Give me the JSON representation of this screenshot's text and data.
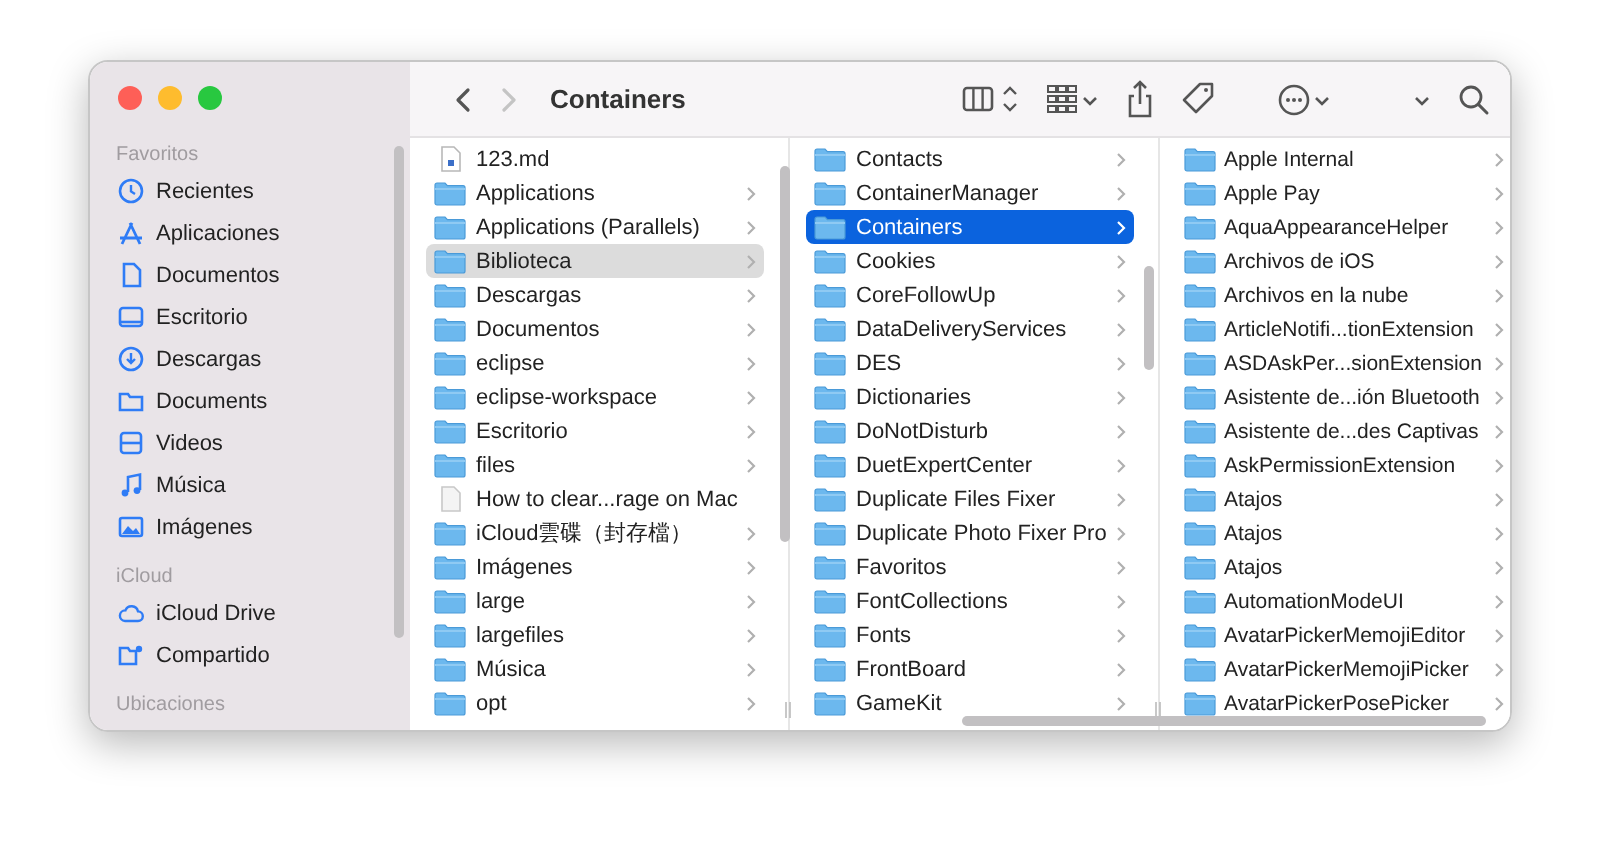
{
  "window": {
    "title": "Containers"
  },
  "toolbar": {
    "nav": [
      {
        "kind": "back",
        "disabled": false
      },
      {
        "kind": "forward",
        "disabled": true
      }
    ],
    "tools": [
      {
        "kind": "column-view"
      },
      {
        "kind": "grid"
      },
      {
        "kind": "share"
      },
      {
        "kind": "tag"
      },
      {
        "kind": "more"
      },
      {
        "kind": "caret"
      },
      {
        "kind": "search"
      }
    ]
  },
  "sidebar": {
    "sections": [
      {
        "header": "Favoritos",
        "items": [
          {
            "label": "Recientes",
            "kind": "clock",
            "selected": false
          },
          {
            "label": "Aplicaciones",
            "kind": "apps",
            "selected": false
          },
          {
            "label": "Documentos",
            "kind": "document",
            "selected": false
          },
          {
            "label": "Escritorio",
            "kind": "desktop",
            "selected": false
          },
          {
            "label": "Descargas",
            "kind": "download",
            "selected": false
          },
          {
            "label": "Documents",
            "kind": "folder",
            "selected": false
          },
          {
            "label": "Videos",
            "kind": "film",
            "selected": false
          },
          {
            "label": "Música",
            "kind": "music",
            "selected": false
          },
          {
            "label": "Imágenes",
            "kind": "photo",
            "selected": false
          }
        ]
      },
      {
        "header": "iCloud",
        "items": [
          {
            "label": "iCloud Drive",
            "kind": "cloud",
            "selected": false
          },
          {
            "label": "Compartido",
            "kind": "shared",
            "selected": false
          }
        ]
      },
      {
        "header": "Ubicaciones"
      }
    ]
  },
  "columns": [
    {
      "items": [
        {
          "label": "123.md",
          "kind": "document",
          "selected": false
        },
        {
          "label": "Applications",
          "kind": "folder",
          "selected": false
        },
        {
          "label": "Applications (Parallels)",
          "kind": "folder",
          "selected": false
        },
        {
          "label": "Biblioteca",
          "kind": "folder",
          "selected": true
        },
        {
          "label": "Descargas",
          "kind": "folder",
          "selected": false
        },
        {
          "label": "Documentos",
          "kind": "folder",
          "selected": false
        },
        {
          "label": "eclipse",
          "kind": "folder",
          "selected": false
        },
        {
          "label": "eclipse-workspace",
          "kind": "folder",
          "selected": false
        },
        {
          "label": "Escritorio",
          "kind": "folder",
          "selected": false
        },
        {
          "label": "files",
          "kind": "folder",
          "selected": false
        },
        {
          "label": "How to clear...rage on Mac",
          "kind": "file",
          "selected": false
        },
        {
          "label": "iCloud雲碟（封存檔）",
          "kind": "folder",
          "selected": false
        },
        {
          "label": "Imágenes",
          "kind": "folder",
          "selected": false
        },
        {
          "label": "large",
          "kind": "folder",
          "selected": false
        },
        {
          "label": "largefiles",
          "kind": "folder",
          "selected": false
        },
        {
          "label": "Música",
          "kind": "folder",
          "selected": false
        },
        {
          "label": "opt",
          "kind": "folder",
          "selected": false
        }
      ]
    },
    {
      "items": [
        {
          "label": "Contacts",
          "kind": "folder",
          "selected": false
        },
        {
          "label": "ContainerManager",
          "kind": "folder",
          "selected": false
        },
        {
          "label": "Containers",
          "kind": "folder",
          "selected": true
        },
        {
          "label": "Cookies",
          "kind": "folder",
          "selected": false
        },
        {
          "label": "CoreFollowUp",
          "kind": "folder",
          "selected": false
        },
        {
          "label": "DataDeliveryServices",
          "kind": "folder",
          "selected": false
        },
        {
          "label": "DES",
          "kind": "folder",
          "selected": false
        },
        {
          "label": "Dictionaries",
          "kind": "folder",
          "selected": false
        },
        {
          "label": "DoNotDisturb",
          "kind": "folder",
          "selected": false
        },
        {
          "label": "DuetExpertCenter",
          "kind": "folder",
          "selected": false
        },
        {
          "label": "Duplicate Files Fixer",
          "kind": "folder",
          "selected": false
        },
        {
          "label": "Duplicate Photo Fixer Pro",
          "kind": "folder",
          "selected": false
        },
        {
          "label": "Favoritos",
          "kind": "folder",
          "selected": false
        },
        {
          "label": "FontCollections",
          "kind": "folder",
          "selected": false
        },
        {
          "label": "Fonts",
          "kind": "folder",
          "selected": false
        },
        {
          "label": "FrontBoard",
          "kind": "folder",
          "selected": false
        },
        {
          "label": "GameKit",
          "kind": "folder",
          "selected": false
        }
      ]
    },
    {
      "items": [
        {
          "label": "Apple Internal",
          "kind": "folder",
          "selected": false
        },
        {
          "label": "Apple Pay",
          "kind": "folder",
          "selected": false
        },
        {
          "label": "AquaAppearanceHelper",
          "kind": "folder",
          "selected": false
        },
        {
          "label": "Archivos de iOS",
          "kind": "folder",
          "selected": false
        },
        {
          "label": "Archivos en la nube",
          "kind": "folder",
          "selected": false
        },
        {
          "label": "ArticleNotifi...tionExtension",
          "kind": "folder",
          "selected": false
        },
        {
          "label": "ASDAskPer...sionExtension",
          "kind": "folder",
          "selected": false
        },
        {
          "label": "Asistente de...ión Bluetooth",
          "kind": "folder",
          "selected": false
        },
        {
          "label": "Asistente de...des Captivas",
          "kind": "folder",
          "selected": false
        },
        {
          "label": "AskPermissionExtension",
          "kind": "folder",
          "selected": false
        },
        {
          "label": "Atajos",
          "kind": "folder",
          "selected": false
        },
        {
          "label": "Atajos",
          "kind": "folder",
          "selected": false
        },
        {
          "label": "Atajos",
          "kind": "folder",
          "selected": false
        },
        {
          "label": "AutomationModeUI",
          "kind": "folder",
          "selected": false
        },
        {
          "label": "AvatarPickerMemojiEditor",
          "kind": "folder",
          "selected": false
        },
        {
          "label": "AvatarPickerMemojiPicker",
          "kind": "folder",
          "selected": false
        },
        {
          "label": "AvatarPickerPosePicker",
          "kind": "folder",
          "selected": false
        }
      ]
    }
  ]
}
